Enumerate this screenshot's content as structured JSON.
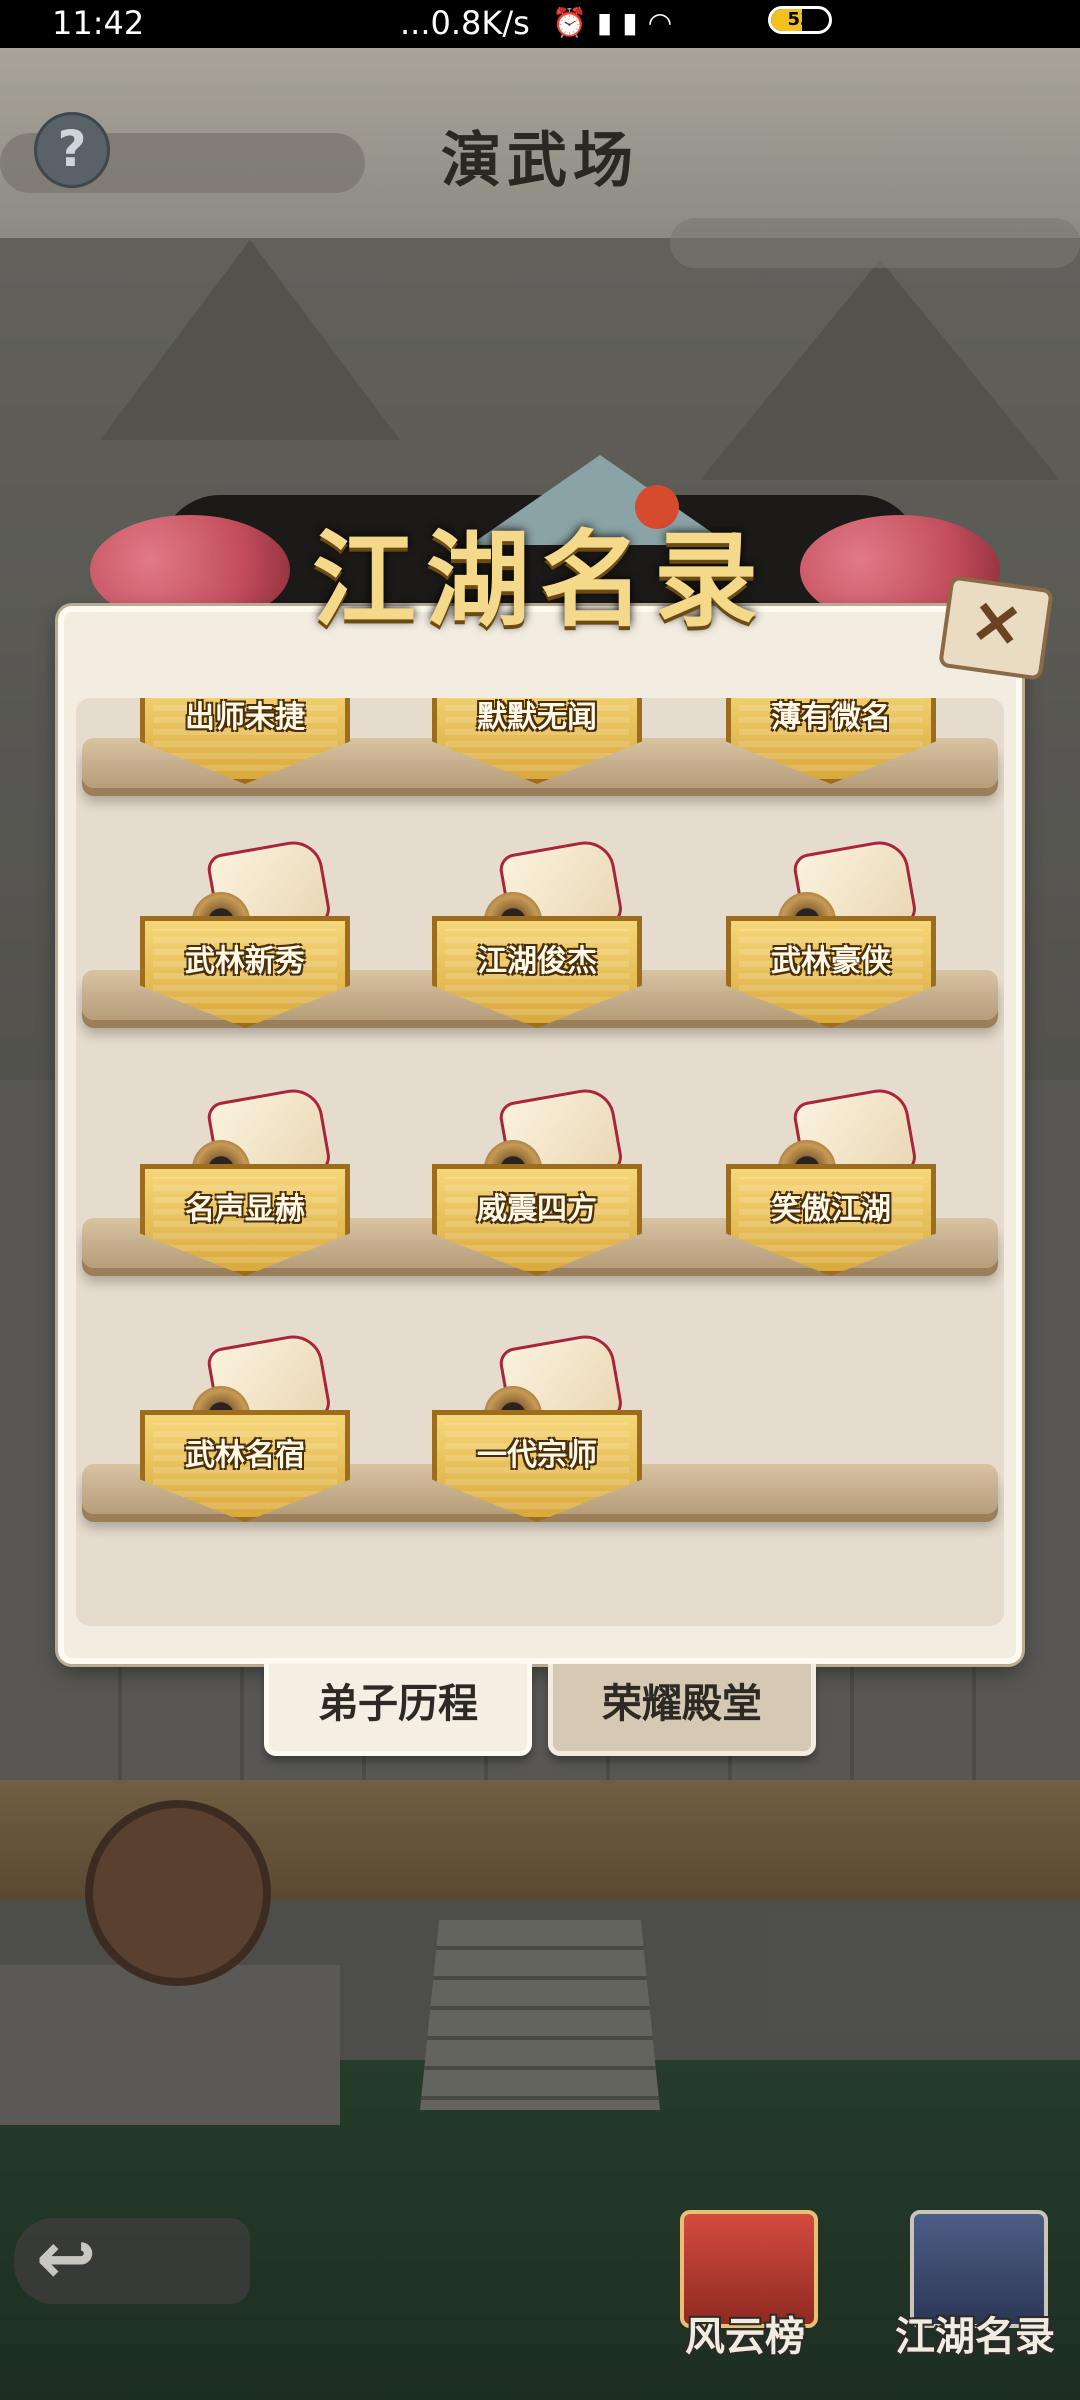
{
  "status_bar": {
    "time": "11:42",
    "network_speed": "...0.8K/s",
    "icons": [
      "alarm-icon",
      "signal-icon",
      "signal-icon",
      "wifi-icon"
    ],
    "battery_level": "53"
  },
  "header": {
    "title": "演武场",
    "help_label": "?"
  },
  "modal": {
    "title": "江湖名录",
    "close_label": "✕",
    "titles": [
      {
        "label": "出师未捷"
      },
      {
        "label": "默默无闻"
      },
      {
        "label": "薄有微名"
      },
      {
        "label": "武林新秀"
      },
      {
        "label": "江湖俊杰"
      },
      {
        "label": "武林豪侠"
      },
      {
        "label": "名声显赫"
      },
      {
        "label": "威震四方"
      },
      {
        "label": "笑傲江湖"
      },
      {
        "label": "武林名宿"
      },
      {
        "label": "一代宗师"
      }
    ],
    "tabs": [
      {
        "label": "弟子历程",
        "active": true
      },
      {
        "label": "荣耀殿堂",
        "active": false
      }
    ]
  },
  "bottom": {
    "back_label": "↩",
    "buttons": [
      {
        "label": "风云榜",
        "icon": "ranking-scroll-icon"
      },
      {
        "label": "江湖名录",
        "icon": "book-icon"
      }
    ]
  },
  "colors": {
    "plaque_gold": "#f6d77a",
    "modal_bg": "#f3ede1",
    "title_gold": "#f4d98a"
  }
}
